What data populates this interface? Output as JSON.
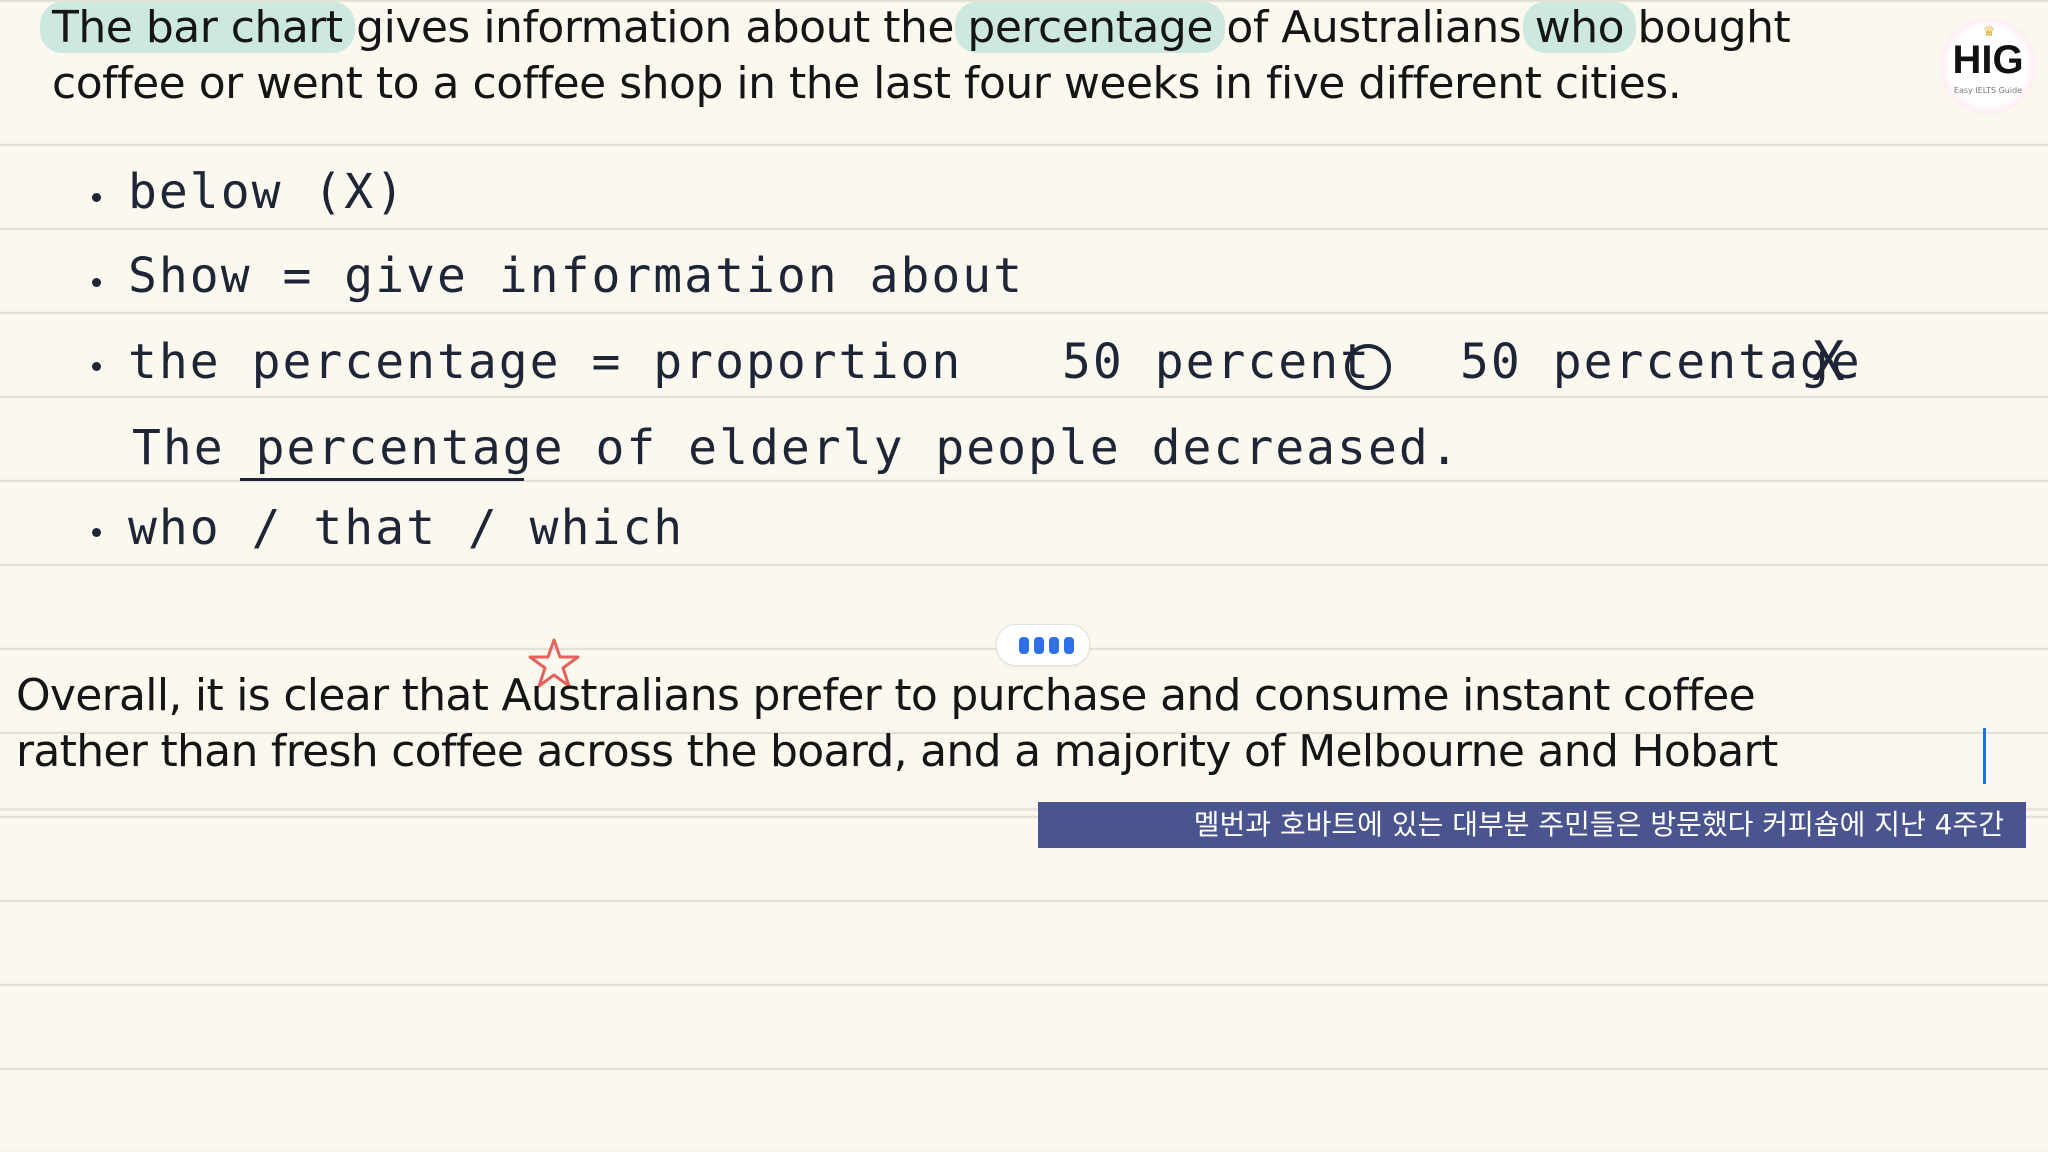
{
  "intro": {
    "line1": [
      {
        "text": "The bar chart",
        "highlight": true
      },
      {
        "text": " gives information about the ",
        "highlight": false
      },
      {
        "text": "percentage",
        "highlight": true
      },
      {
        "text": " of Australians ",
        "highlight": false
      },
      {
        "text": "who",
        "highlight": true
      },
      {
        "text": " bought",
        "highlight": false
      }
    ],
    "line2": "coffee or went to a coffee shop in the last four weeks in five different cities."
  },
  "logo": {
    "text": "HIG",
    "subtext": "Easy IELTS Guide"
  },
  "notes": [
    {
      "text": "below (X)"
    },
    {
      "text": "Show  =  give  information  about"
    },
    {
      "text": "the  percentage  =  proportion",
      "extra1": "50 percent",
      "extra2": "50 percentage",
      "extra2_mark": "X"
    },
    {
      "text": "The  percentage  of  elderly  people  decreased."
    },
    {
      "text": "who / that / which"
    }
  ],
  "overall": {
    "line1": "Overall, it is clear that Australians prefer to purchase and consume instant coffee",
    "line2": "rather than fresh coffee across the board, and a majority of Melbourne and Hobart"
  },
  "subtitle": "멜번과 호바트에 있는 대부분 주민들은 방문했다 커피숍에 지난 4주간",
  "colors": {
    "highlight": "#cde9df",
    "subtitle_bg": "#4a5590",
    "star": "#e8605a",
    "handle_dots": "#2f6fe8",
    "caret": "#1e6dff"
  }
}
